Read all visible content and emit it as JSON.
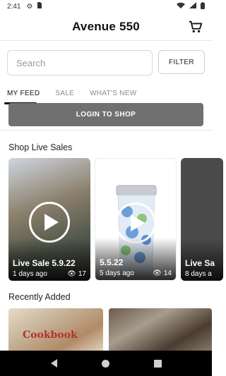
{
  "status_bar": {
    "time": "2:41"
  },
  "header": {
    "title": "Avenue 550"
  },
  "search": {
    "placeholder": "Search",
    "filter_label": "FILTER"
  },
  "tabs": [
    {
      "label": "MY FEED",
      "active": true
    },
    {
      "label": "SALE",
      "active": false
    },
    {
      "label": "WHAT'S NEW",
      "active": false
    }
  ],
  "login": {
    "label": "LOGIN TO SHOP"
  },
  "live_sales": {
    "title": "Shop Live Sales",
    "cards": [
      {
        "title": "Live Sale 5.9.22",
        "meta": "1 days ago",
        "views": "17"
      },
      {
        "title": "5.5.22",
        "meta": "5 days ago",
        "views": "14"
      },
      {
        "title": "Live Sa",
        "meta": "8 days a",
        "views": ""
      }
    ]
  },
  "recent": {
    "title": "Recently Added",
    "items": [
      {
        "label": "Cookbook"
      },
      {
        "label": ""
      }
    ]
  },
  "colors": {
    "login_bg": "#707070",
    "accent": "#111111"
  }
}
